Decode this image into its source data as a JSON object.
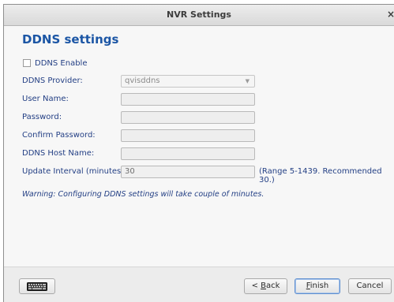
{
  "window": {
    "title": "NVR Settings",
    "close_glyph": "×"
  },
  "page": {
    "heading": "DDNS settings"
  },
  "form": {
    "ddns_enable": {
      "label": "DDNS Enable",
      "checked": false
    },
    "provider": {
      "label": "DDNS Provider:",
      "value": "qvisddns"
    },
    "user_name": {
      "label": "User Name:",
      "value": ""
    },
    "password": {
      "label": "Password:",
      "value": ""
    },
    "confirm_password": {
      "label": "Confirm Password:",
      "value": ""
    },
    "host_name": {
      "label": "DDNS Host Name:",
      "value": ""
    },
    "update_interval": {
      "label": "Update Interval (minutes)",
      "value": "30",
      "range_note": "(Range 5-1439. Recommended 30.)"
    },
    "warning": "Warning: Configuring DDNS settings will take couple of minutes."
  },
  "buttons": {
    "back_prefix": "< ",
    "back_mnemonic": "B",
    "back_rest": "ack",
    "finish_mnemonic": "F",
    "finish_rest": "inish",
    "cancel": "Cancel"
  },
  "icons": {
    "keyboard": "keyboard-icon",
    "dropdown": "chevron-down-icon",
    "close": "close-icon"
  },
  "colors": {
    "heading": "#1c56a5",
    "label": "#233f84",
    "default_button_border": "#5f8fcf"
  }
}
